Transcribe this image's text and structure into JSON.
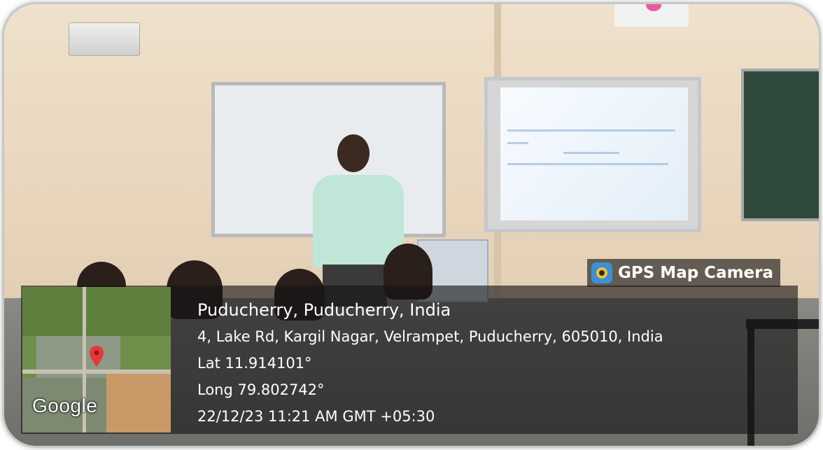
{
  "badge": {
    "label": "GPS Map Camera",
    "icon": "camera-lens-icon"
  },
  "location": {
    "title": "Puducherry, Puducherry, India",
    "address": "4, Lake Rd, Kargil Nagar, Velrampet, Puducherry, 605010, India",
    "latitude": "Lat 11.914101°",
    "longitude": "Long 79.802742°",
    "datetime": "22/12/23 11:21 AM GMT +05:30"
  },
  "map": {
    "provider": "Google",
    "pin_icon": "map-pin-icon",
    "pin_color": "#e53935"
  },
  "colors": {
    "overlay": "#141414",
    "text": "#ffffff"
  }
}
